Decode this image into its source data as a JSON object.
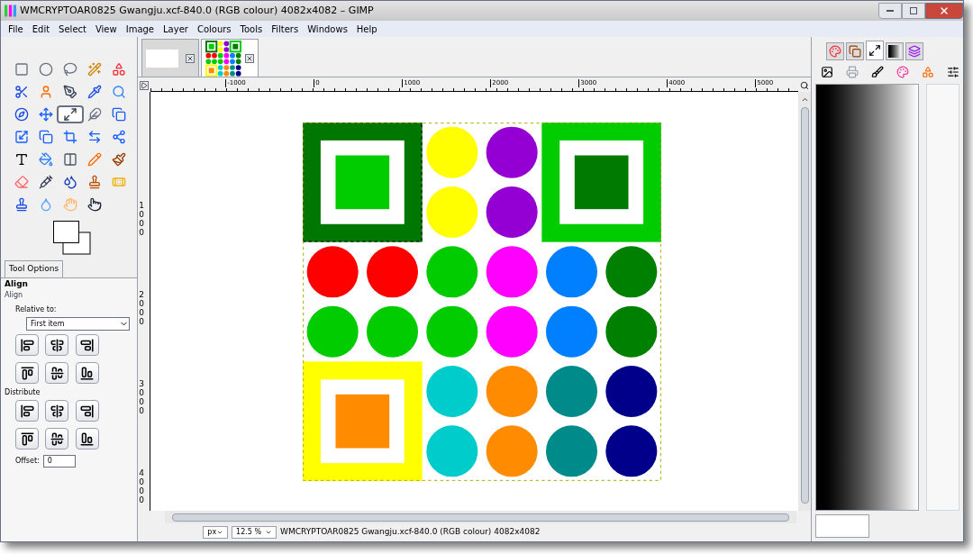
{
  "window": {
    "title": "WMCRYPTOAR0825 Gwangju.xcf-840.0 (RGB colour) 4082x4082 – GIMP"
  },
  "menu": [
    "File",
    "Edit",
    "Select",
    "View",
    "Image",
    "Layer",
    "Colours",
    "Tools",
    "Filters",
    "Windows",
    "Help"
  ],
  "toolbox": {
    "tools": [
      {
        "selected": false
      },
      {
        "selected": false
      },
      {
        "selected": false
      },
      {
        "selected": false
      },
      {
        "selected": false
      },
      {
        "selected": false
      },
      {
        "selected": false
      },
      {
        "selected": false
      },
      {
        "selected": false
      },
      {
        "selected": false
      },
      {
        "selected": false
      },
      {
        "selected": false
      },
      {
        "selected": true
      },
      {
        "selected": false
      },
      {
        "selected": false
      },
      {
        "selected": false
      },
      {
        "selected": false
      },
      {
        "selected": false
      },
      {
        "selected": false
      },
      {
        "selected": false
      },
      {
        "selected": false
      },
      {
        "selected": false
      },
      {
        "selected": false
      },
      {
        "selected": false
      },
      {
        "selected": false
      },
      {
        "selected": false
      },
      {
        "selected": false
      },
      {
        "selected": false
      },
      {
        "selected": false
      },
      {
        "selected": false
      },
      {
        "selected": false
      },
      {
        "selected": false
      },
      {
        "selected": false
      },
      {
        "selected": false
      }
    ]
  },
  "tool_options": {
    "tab": "Tool Options",
    "tool": "Align",
    "section": "Align",
    "relative_label": "Relative to:",
    "relative_value": "First item",
    "distribute_label": "Distribute",
    "offset_label": "Offset:",
    "offset_value": "0"
  },
  "image_tabs": [
    {
      "selected": false
    },
    {
      "selected": true
    }
  ],
  "ruler": {
    "horizontal": [
      "-1000",
      "0",
      "1000",
      "2000",
      "3000",
      "4000",
      "5000"
    ],
    "vertical": [
      "1000",
      "2000",
      "3000",
      "4000"
    ]
  },
  "status_bar": {
    "unit": "px",
    "zoom": "12.5 %",
    "text": "WMCRYPTOAR0825 Gwangju.xcf-840.0 (RGB colour) 4082x4082"
  },
  "dock_tabs": [
    {
      "selected": false
    },
    {
      "selected": false
    },
    {
      "selected": true
    },
    {
      "selected": false
    },
    {
      "selected": false
    }
  ]
}
